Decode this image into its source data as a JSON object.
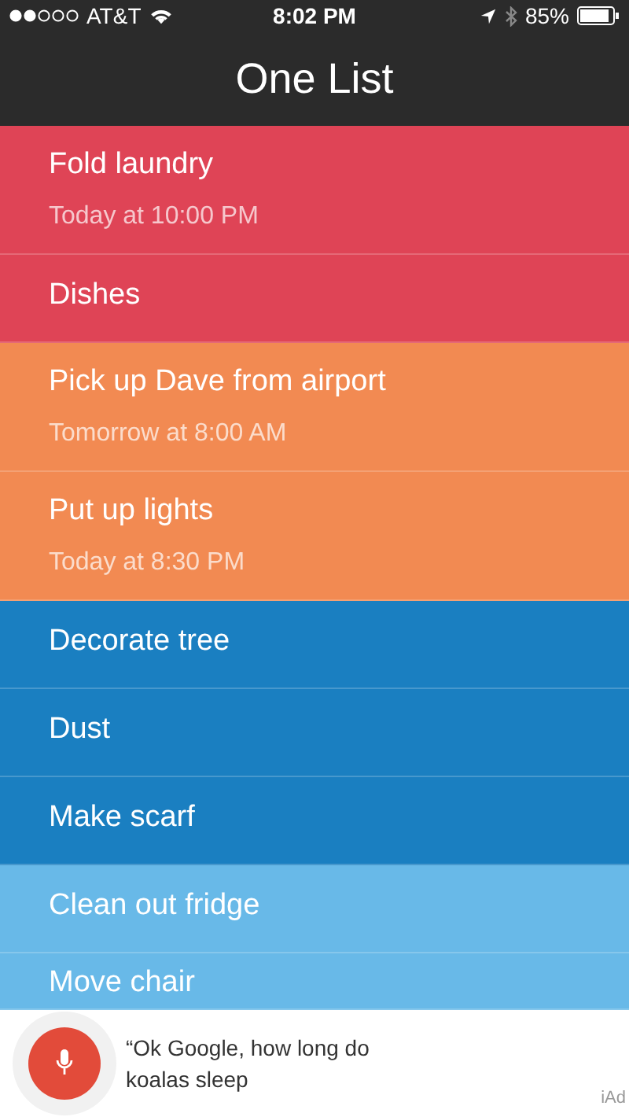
{
  "status_bar": {
    "carrier": "AT&T",
    "time": "8:02 PM",
    "battery": "85%"
  },
  "nav": {
    "title": "One List"
  },
  "items": [
    {
      "title": "Fold laundry",
      "subtitle": "Today at 10:00 PM",
      "color": "#df4456"
    },
    {
      "title": "Dishes",
      "color": "#df4456"
    },
    {
      "title": "Pick up Dave from airport",
      "subtitle": "Tomorrow at 8:00 AM",
      "color": "#f28a52"
    },
    {
      "title": "Put up lights",
      "subtitle": "Today at 8:30 PM",
      "color": "#f28a52"
    },
    {
      "title": "Decorate tree",
      "color": "#1a7fc1"
    },
    {
      "title": "Dust",
      "color": "#1a7fc1"
    },
    {
      "title": "Make scarf",
      "color": "#1a7fc1"
    },
    {
      "title": "Clean out fridge",
      "color": "#68b9e8"
    },
    {
      "title": "Move chair",
      "color": "#68b9e8"
    }
  ],
  "ad": {
    "text": "“Ok Google, how long do koalas sleep",
    "badge": "iAd"
  }
}
